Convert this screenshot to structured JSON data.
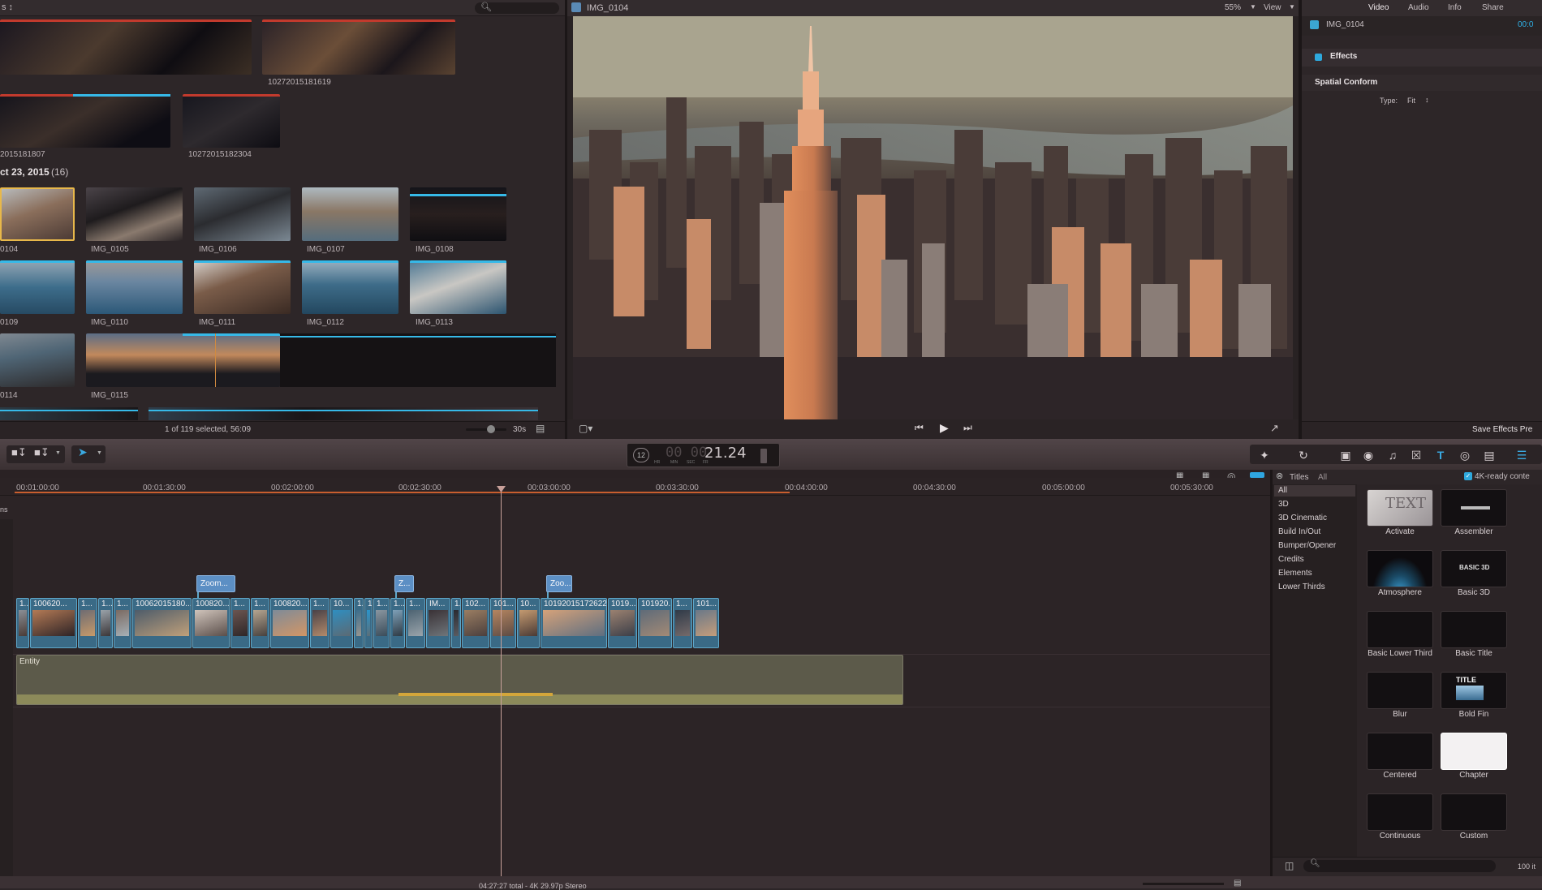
{
  "browser": {
    "top_left_label": "s ↕",
    "search_icon": "search-icon",
    "clips_top": [
      {
        "name": "10272015181619"
      },
      {
        "name": "2015181807"
      },
      {
        "name": "10272015182304"
      }
    ],
    "date_header": "ct 23, 2015",
    "date_count": "(16)",
    "grid": [
      {
        "name": "0104"
      },
      {
        "name": "IMG_0105"
      },
      {
        "name": "IMG_0106"
      },
      {
        "name": "IMG_0107"
      },
      {
        "name": "IMG_0108"
      },
      {
        "name": "0109"
      },
      {
        "name": "IMG_0110"
      },
      {
        "name": "IMG_0111"
      },
      {
        "name": "IMG_0112"
      },
      {
        "name": "IMG_0113"
      },
      {
        "name": "0114"
      },
      {
        "name": "IMG_0115"
      }
    ],
    "status": "1 of 119 selected, 56:09",
    "duration": "30s"
  },
  "viewer": {
    "clip_name": "IMG_0104",
    "zoom": "55%",
    "view_label": "View"
  },
  "inspector": {
    "tabs": [
      "Video",
      "Audio",
      "Info",
      "Share"
    ],
    "clip_name": "IMG_0104",
    "timecode": "00:0",
    "effects_label": "Effects",
    "spatial_conform": "Spatial Conform",
    "type_label": "Type:",
    "type_value": "Fit",
    "save_button": "Save Effects Pre"
  },
  "toolbar": {
    "timecode_prefix": "12",
    "timecode_dim": "00 00",
    "timecode_main": "21.24",
    "timecode_units": [
      "HR",
      "MIN",
      "SEC",
      "FR"
    ]
  },
  "timeline": {
    "ruler": [
      "00:01:00:00",
      "00:01:30:00",
      "00:02:00:00",
      "00:02:30:00",
      "00:03:00:00",
      "00:03:30:00",
      "00:04:00:00",
      "00:04:30:00",
      "00:05:00:00",
      "00:05:30:00"
    ],
    "side_label": "ns",
    "title_clips": [
      "Zoom...",
      "Z...",
      "Zoo..."
    ],
    "clips": [
      {
        "label": "1..."
      },
      {
        "label": "100620..."
      },
      {
        "label": "1..."
      },
      {
        "label": "1..."
      },
      {
        "label": "1..."
      },
      {
        "label": "10062015180..."
      },
      {
        "label": "100820..."
      },
      {
        "label": "1..."
      },
      {
        "label": "1..."
      },
      {
        "label": "100820..."
      },
      {
        "label": "1..."
      },
      {
        "label": "10..."
      },
      {
        "label": "1..."
      },
      {
        "label": "1..."
      },
      {
        "label": "1..."
      },
      {
        "label": "1..."
      },
      {
        "label": "1..."
      },
      {
        "label": "IM..."
      },
      {
        "label": "1..."
      },
      {
        "label": "102..."
      },
      {
        "label": "101..."
      },
      {
        "label": "10..."
      },
      {
        "label": "10192015172622"
      },
      {
        "label": "1019..."
      },
      {
        "label": "101920..."
      },
      {
        "label": "1..."
      },
      {
        "label": "101..."
      }
    ],
    "audio_label": "Entity",
    "footer": "04:27:27 total - 4K 29.97p Stereo"
  },
  "titles_browser": {
    "header": "Titles",
    "all_label": "All",
    "fourk_label": "4K-ready conte",
    "categories": [
      "All",
      "3D",
      "3D Cinematic",
      "Build In/Out",
      "Bumper/Opener",
      "Credits",
      "Elements",
      "Lower Thirds"
    ],
    "items": [
      "Activate",
      "Assembler",
      "Atmosphere",
      "Basic 3D",
      "Basic Lower Third",
      "Basic Title",
      "Blur",
      "Bold Fin",
      "Centered",
      "Chapter",
      "Continuous",
      "Custom"
    ],
    "thumb_texts": {
      "activate": "TEXT",
      "basic3d": "BASIC 3D",
      "title": "TITLE"
    },
    "count": "100 it"
  },
  "colors": {
    "accent": "#36b9e8",
    "clip": "#3a6a86",
    "title_clip": "#5c8fc4",
    "playhead": "#c8a09a"
  }
}
